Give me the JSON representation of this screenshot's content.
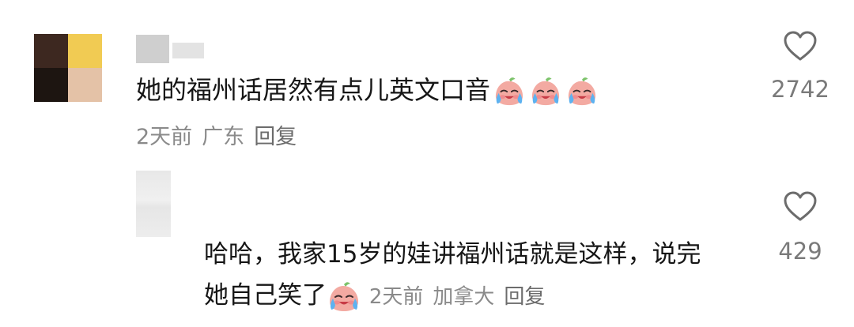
{
  "comment": {
    "text": "她的福州话居然有点儿英文口音",
    "emoji_icon": "loudly-crying-face-icon",
    "emoji_count": 3,
    "time": "2天前",
    "location": "广东",
    "reply_label": "回复",
    "likes": "2742"
  },
  "reply": {
    "text": "哈哈，我家15岁的娃讲福州话就是这样，说完她自己笑了",
    "emoji_icon": "loudly-crying-face-icon",
    "time": "2天前",
    "location": "加拿大",
    "reply_label": "回复",
    "likes": "429"
  },
  "colors": {
    "text": "#161616",
    "meta": "#8a8a8a",
    "icon": "#6c6c6c",
    "emoji_face": "#f3a8a0"
  }
}
